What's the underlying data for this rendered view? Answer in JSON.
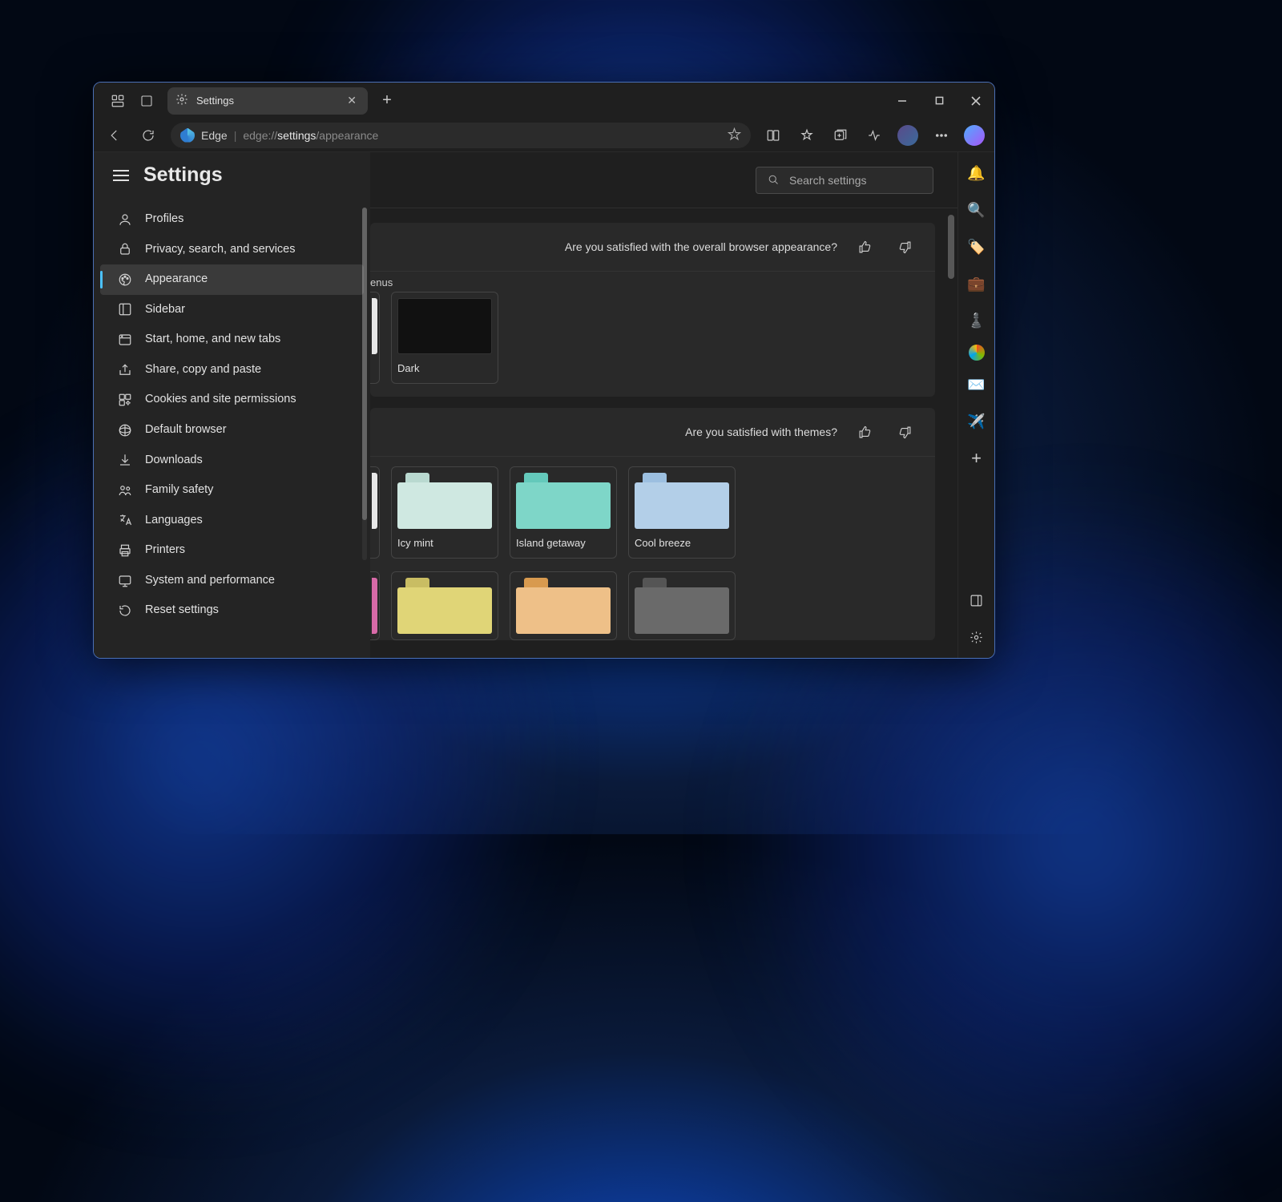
{
  "os_background": "Windows 11 Bloom (blue)",
  "window": {
    "title": "Settings",
    "win_buttons": {
      "min": "–",
      "max": "▢",
      "close": "✕"
    }
  },
  "titlebar": {
    "tab_title": "Settings",
    "new_tab_tooltip": "+"
  },
  "toolbar": {
    "back": "←",
    "refresh": "⟳",
    "edge_label": "Edge",
    "url_scheme": "edge://",
    "url_path_strong": "settings",
    "url_path_rest": "/appearance",
    "favorite": "☆",
    "icons": [
      "split-screen",
      "favorites",
      "collections",
      "performance",
      "profile",
      "more"
    ]
  },
  "settings": {
    "heading": "Settings",
    "search_placeholder": "Search settings",
    "nav": [
      {
        "id": "profiles",
        "label": "Profiles"
      },
      {
        "id": "privacy",
        "label": "Privacy, search, and services"
      },
      {
        "id": "appearance",
        "label": "Appearance",
        "active": true
      },
      {
        "id": "sidebar",
        "label": "Sidebar"
      },
      {
        "id": "start",
        "label": "Start, home, and new tabs"
      },
      {
        "id": "share",
        "label": "Share, copy and paste"
      },
      {
        "id": "cookies",
        "label": "Cookies and site permissions"
      },
      {
        "id": "default",
        "label": "Default browser"
      },
      {
        "id": "downloads",
        "label": "Downloads"
      },
      {
        "id": "family",
        "label": "Family safety"
      },
      {
        "id": "languages",
        "label": "Languages"
      },
      {
        "id": "printers",
        "label": "Printers"
      },
      {
        "id": "system",
        "label": "System and performance"
      },
      {
        "id": "reset",
        "label": "Reset settings"
      }
    ]
  },
  "appearance": {
    "menus_fragment": "enus",
    "feedback1": "Are you satisfied with the overall browser appearance?",
    "dark_card": "Dark",
    "feedback2": "Are you satisfied with themes?",
    "themes_row1": [
      {
        "name": "Icy mint",
        "tab": "#b9d9d0",
        "body": "#cfe8e1"
      },
      {
        "name": "Island getaway",
        "tab": "#64c9bb",
        "body": "#7ed6c8"
      },
      {
        "name": "Cool breeze",
        "tab": "#9cbfe0",
        "body": "#b3cfe8"
      }
    ],
    "themes_row2": [
      {
        "name": "",
        "tab": "#c9bd63",
        "body": "#e0d577"
      },
      {
        "name": "",
        "tab": "#d89a4f",
        "body": "#eec088"
      },
      {
        "name": "",
        "tab": "#555555",
        "body": "#6a6a6a"
      }
    ],
    "partial_left_row1": "#e8e8e8",
    "partial_left_row2": "#d86aa8"
  },
  "edge_sidebar": {
    "items": [
      "🔔",
      "🔍",
      "🏷️",
      "💼",
      "♟️",
      "🟣",
      "📧",
      "✈️",
      "+"
    ],
    "bottom": [
      "▢",
      "⚙"
    ]
  }
}
